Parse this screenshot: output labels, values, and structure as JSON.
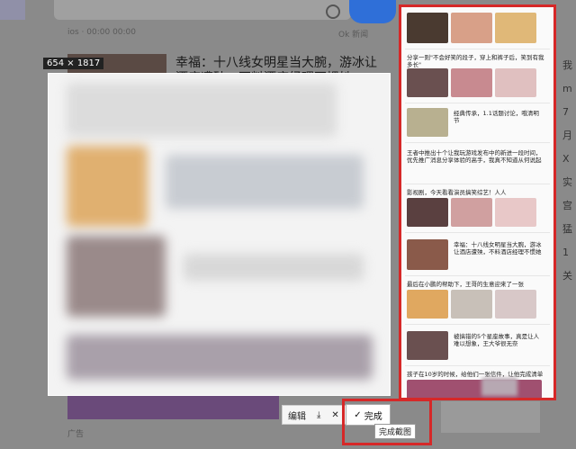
{
  "background": {
    "meta_left": "ios · 00:00 00:00",
    "meta_right": "Ok 新闻",
    "headline": "幸福：十八线女明星当大腕，游冰让酒店遭殃，不料酒店经理不惯她",
    "right_chars": [
      "我",
      "m",
      "7月",
      "X",
      "实",
      "宫",
      "猛",
      "1关"
    ],
    "footer": "广告"
  },
  "capture": {
    "size_label": "654 × 1817"
  },
  "toolbar": {
    "edit_label": "编辑",
    "done_label": "完成",
    "tooltip": "完成截图"
  },
  "phone": {
    "items": [
      {
        "text": "分享一则\"不会好笑的段子，穿上和裤子后，笑到有我多长\""
      },
      {
        "text": "经典传承，1.1话题讨论，哦清明节"
      },
      {
        "text": "王者中推出十个让我玩游戏发布中的新进一段时间，优先推广消息分享体验的高手，我真不知道从何说起"
      },
      {
        "text": "影视剧，今天看看演员搞笑综艺！人人"
      },
      {
        "text": "幸福：十八线女明星当大腕，游冰让酒店遭殃，不料酒店经理不惯她"
      },
      {
        "text": "最后在小鹏的帮助下，王哥的生意迎来了一张"
      },
      {
        "text": "被搞错的5个星座故事，真是让人难以想象，王大爷很无奈"
      },
      {
        "text": "孩子在10岁的时候，给他们一张信件，让他完成清单"
      }
    ]
  },
  "colors": {
    "highlight_red": "#d62828",
    "search_blue": "#2f6fd8"
  }
}
